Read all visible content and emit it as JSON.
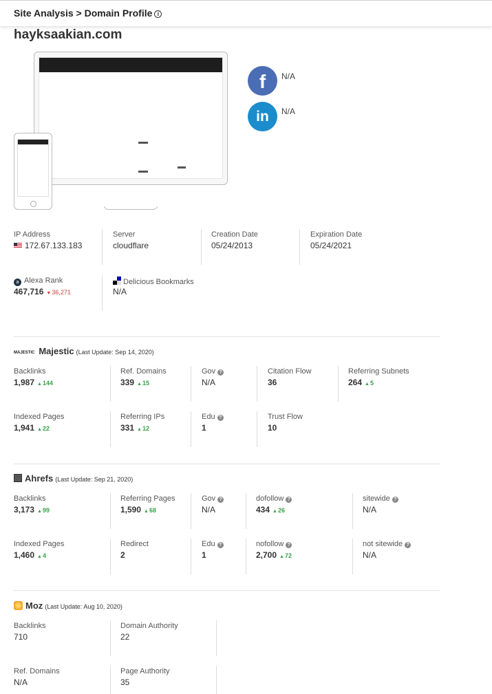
{
  "header": {
    "title": "Site Analysis > Domain Profile"
  },
  "domain": "hayksaakian.com",
  "social": {
    "facebook": {
      "value": "N/A"
    },
    "linkedin": {
      "value": "N/A"
    }
  },
  "overview": {
    "ip_label": "IP Address",
    "ip_value": "172.67.133.183",
    "server_label": "Server",
    "server_value": "cloudflare",
    "creation_label": "Creation Date",
    "creation_value": "05/24/2013",
    "expiration_label": "Expiration Date",
    "expiration_value": "05/24/2021",
    "alexa_label": "Alexa Rank",
    "alexa_value": "467,716",
    "alexa_change": "36,271",
    "delicious_label": "Delicious Bookmarks",
    "delicious_value": "N/A"
  },
  "majestic": {
    "title": "Majestic",
    "update": "(Last Update: Sep 14, 2020)",
    "backlinks_label": "Backlinks",
    "backlinks_value": "1,987",
    "backlinks_change": "144",
    "ref_domains_label": "Ref. Domains",
    "ref_domains_value": "339",
    "ref_domains_change": "15",
    "gov_label": "Gov",
    "gov_value": "N/A",
    "citation_label": "Citation Flow",
    "citation_value": "36",
    "subnets_label": "Referring Subnets",
    "subnets_value": "264",
    "subnets_change": "5",
    "indexed_label": "Indexed Pages",
    "indexed_value": "1,941",
    "indexed_change": "22",
    "ref_ips_label": "Referring IPs",
    "ref_ips_value": "331",
    "ref_ips_change": "12",
    "edu_label": "Edu",
    "edu_value": "1",
    "trust_label": "Trust Flow",
    "trust_value": "10"
  },
  "ahrefs": {
    "title": "Ahrefs",
    "update": "(Last Update: Sep 21, 2020)",
    "backlinks_label": "Backlinks",
    "backlinks_value": "3,173",
    "backlinks_change": "99",
    "ref_pages_label": "Referring Pages",
    "ref_pages_value": "1,590",
    "ref_pages_change": "68",
    "gov_label": "Gov",
    "gov_value": "N/A",
    "dofollow_label": "dofollow",
    "dofollow_value": "434",
    "dofollow_change": "26",
    "sitewide_label": "sitewide",
    "sitewide_value": "N/A",
    "indexed_label": "Indexed Pages",
    "indexed_value": "1,460",
    "indexed_change": "4",
    "redirect_label": "Redirect",
    "redirect_value": "2",
    "edu_label": "Edu",
    "edu_value": "1",
    "nofollow_label": "nofollow",
    "nofollow_value": "2,700",
    "nofollow_change": "72",
    "not_sitewide_label": "not sitewide",
    "not_sitewide_value": "N/A"
  },
  "moz": {
    "title": "Moz",
    "update": "(Last Update: Aug 10, 2020)",
    "backlinks_label": "Backlinks",
    "backlinks_value": "710",
    "da_label": "Domain Authority",
    "da_value": "22",
    "ref_domains_label": "Ref. Domains",
    "ref_domains_value": "N/A",
    "pa_label": "Page Authority",
    "pa_value": "35"
  },
  "colors": {
    "up": "#3aa14a",
    "down": "#d03a3a",
    "facebook": "#4a6db5",
    "linkedin": "#1b8ccc"
  },
  "icons": [
    "info-icon",
    "us-flag-icon",
    "alexa-icon",
    "delicious-icon",
    "majestic-logo-icon",
    "ahrefs-icon",
    "moz-icon",
    "help-icon"
  ]
}
